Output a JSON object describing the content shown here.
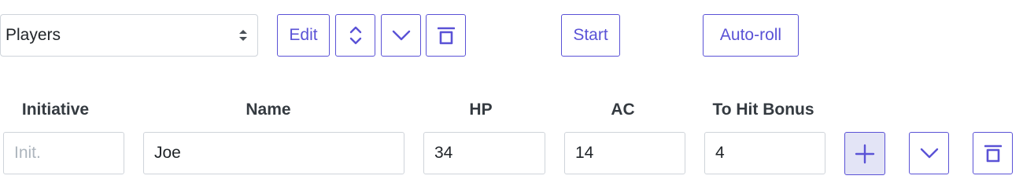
{
  "toolbar": {
    "group_select": {
      "selected": "Players",
      "icon": "sort-caret-icon"
    },
    "edit_label": "Edit",
    "reorder_icon": "chevron-up-down-icon",
    "expand_icon": "chevron-down-icon",
    "delete_icon": "trash-icon",
    "start_label": "Start",
    "auto_roll_label": "Auto-roll"
  },
  "table": {
    "headers": {
      "initiative": "Initiative",
      "name": "Name",
      "hp": "HP",
      "ac": "AC",
      "to_hit_bonus": "To Hit Bonus"
    },
    "row": {
      "initiative": {
        "value": "",
        "placeholder": "Init."
      },
      "name": {
        "value": "Joe"
      },
      "hp": {
        "value": "34"
      },
      "ac": {
        "value": "14"
      },
      "to_hit_bonus": {
        "value": "4"
      },
      "add_icon": "plus-icon",
      "expand_icon": "chevron-down-icon",
      "delete_icon": "trash-icon"
    }
  },
  "colors": {
    "accent": "#5a52d6",
    "border": "#cfd4da",
    "active_button_bg": "#e3e4f6"
  }
}
